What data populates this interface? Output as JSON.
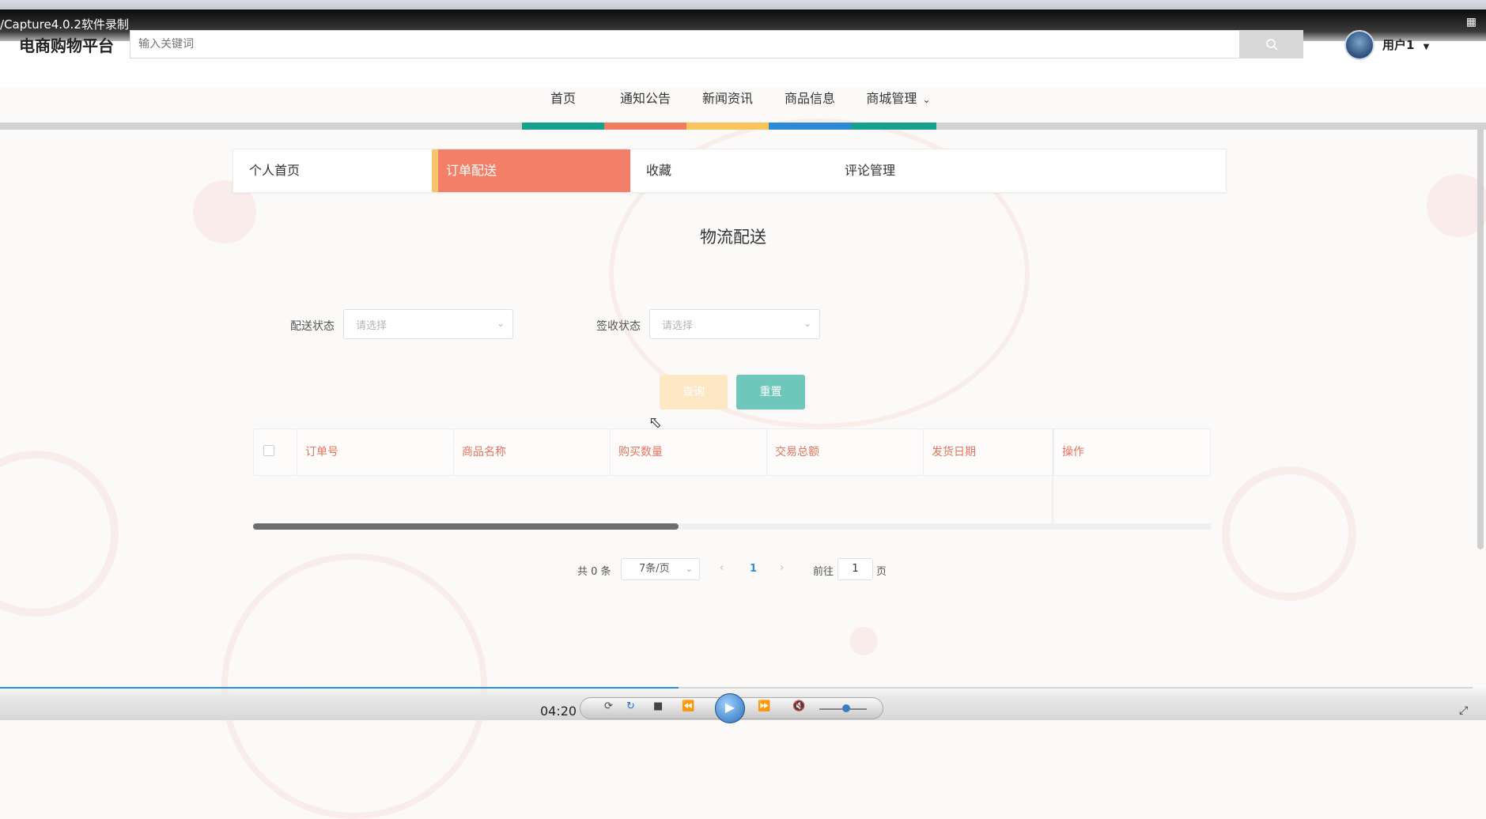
{
  "recorder": {
    "title": "/Capture4.0.2软件录制",
    "expand_icon": "expand-icon",
    "time": "04:20",
    "progress_fraction": 0.46,
    "volume_fraction": 0.5
  },
  "header": {
    "logo": "电商购物平台",
    "search_placeholder": "输入关键词",
    "username": "用户1"
  },
  "nav": {
    "items": [
      "首页",
      "通知公告",
      "新闻资讯",
      "商品信息",
      "商城管理"
    ],
    "colors": [
      "#16a08d",
      "#f07c5e",
      "#f8c45b",
      "#2c8bd8",
      "#16a08d"
    ]
  },
  "tabs": {
    "items": [
      "个人首页",
      "订单配送",
      "收藏",
      "评论管理"
    ],
    "active_index": 1
  },
  "page": {
    "title": "物流配送"
  },
  "filters": {
    "delivery_label": "配送状态",
    "delivery_placeholder": "请选择",
    "sign_label": "签收状态",
    "sign_placeholder": "请选择",
    "query_button": "查询",
    "reset_button": "重置"
  },
  "table": {
    "columns": [
      "订单号",
      "商品名称",
      "购买数量",
      "交易总额",
      "发货日期",
      "操作"
    ],
    "rows": []
  },
  "pagination": {
    "total_text": "共 0 条",
    "page_size": "7条/页",
    "current_page": "1",
    "goto_prefix": "前往",
    "goto_value": "1",
    "goto_suffix": "页"
  }
}
